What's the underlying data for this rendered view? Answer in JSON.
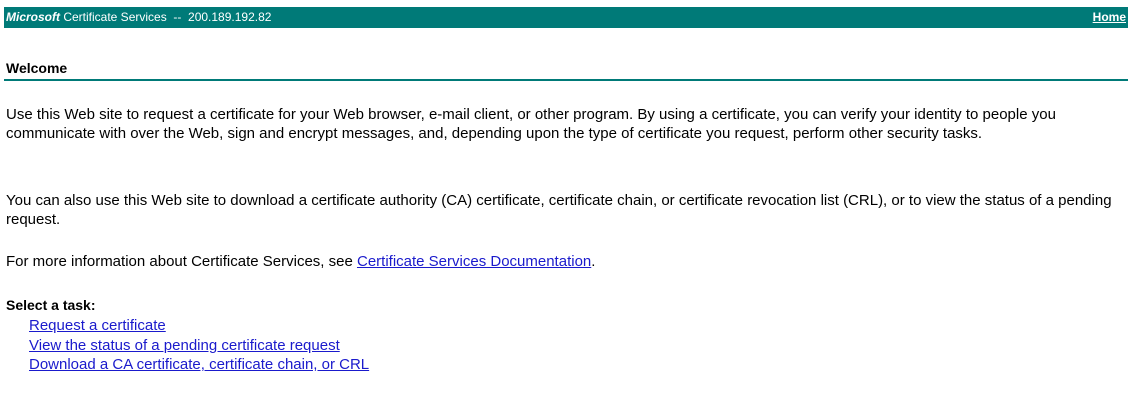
{
  "header": {
    "brand": "Microsoft",
    "title_rest": " Certificate Services  --  200.189.192.82",
    "home_label": "Home"
  },
  "welcome": {
    "heading": "Welcome"
  },
  "paragraphs": {
    "p1": "Use this Web site to request a certificate for your Web browser, e-mail client, or other program. By using a certificate, you can verify your identity to people you communicate with over the Web, sign and encrypt messages, and, depending upon the type of certificate you request, perform other security tasks.",
    "p2": "You can also use this Web site to download a certificate authority (CA) certificate, certificate chain, or certificate revocation list (CRL), or to view the status of a pending request.",
    "p3_before": "For more information about Certificate Services, see ",
    "p3_link": "Certificate Services Documentation",
    "p3_after": "."
  },
  "tasks": {
    "heading": "Select a task:",
    "items": [
      "Request a certificate",
      "View the status of a pending certificate request",
      "Download a CA certificate, certificate chain, or CRL"
    ]
  },
  "colors": {
    "header_bg": "#007a78",
    "link": "#1a1acc"
  }
}
